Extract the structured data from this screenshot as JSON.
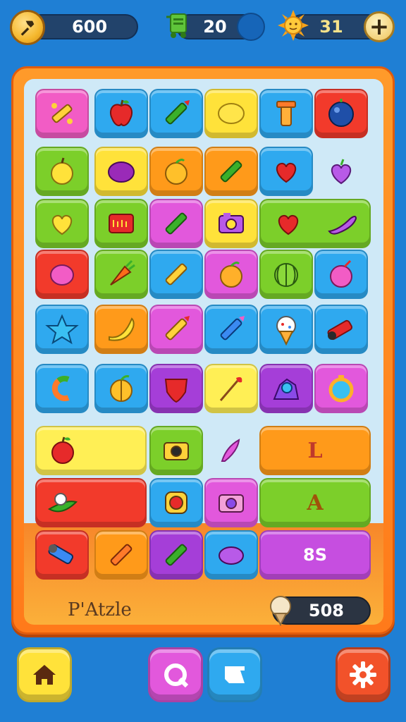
{
  "top_bar": {
    "coins": "600",
    "cart_count": "20",
    "sun_count": "31",
    "coin_icon": "hammer-coin-icon",
    "cart_icon": "cart-icon",
    "sun_icon": "sun-icon",
    "plus_label": "+"
  },
  "board": {
    "wide_labels": {
      "row7_right": "L",
      "row8_right": "A",
      "row9_right": "8S"
    }
  },
  "footer": {
    "title": "P'Atzle",
    "score": "508"
  },
  "nav": {
    "home": "home-icon",
    "refresh": "refresh-icon",
    "share": "share-icon",
    "settings": "gear-icon"
  },
  "colors": {
    "background": "#1f7fd4",
    "board_frame": "#ff8a1f",
    "board_inner": "#cfe9f7"
  }
}
